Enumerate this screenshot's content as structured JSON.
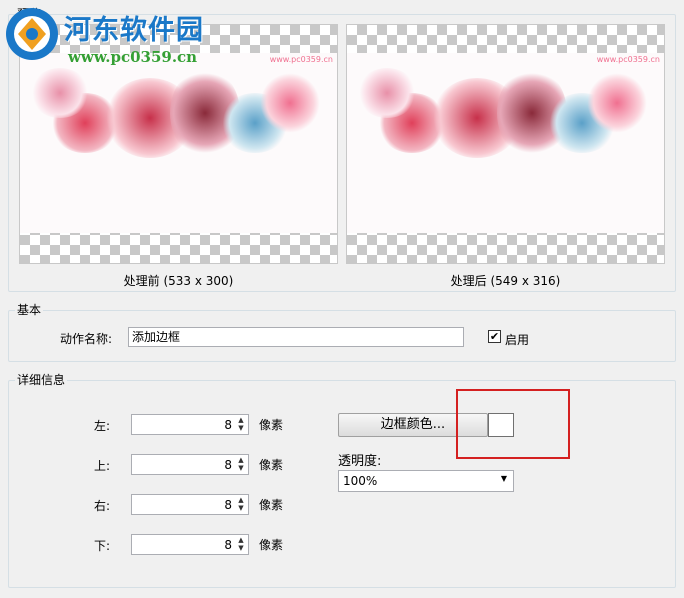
{
  "watermark": {
    "title": "河东软件园",
    "url": "www.pc0359.cn"
  },
  "preview": {
    "group_title": "预览",
    "before_label": "处理前 (533 x 300)",
    "after_label": "处理后 (549 x 316)",
    "image_tag": "www.pc0359.cn"
  },
  "basic": {
    "group_title": "基本",
    "action_name_label": "动作名称:",
    "action_name_value": "添加边框",
    "enable_label": "启用",
    "enable_checked": "✔"
  },
  "details": {
    "group_title": "详细信息",
    "fields": [
      {
        "label": "左:",
        "value": "8",
        "unit": "像素"
      },
      {
        "label": "上:",
        "value": "8",
        "unit": "像素"
      },
      {
        "label": "右:",
        "value": "8",
        "unit": "像素"
      },
      {
        "label": "下:",
        "value": "8",
        "unit": "像素"
      }
    ],
    "border_color_button": "边框颜色...",
    "border_color": "#ffffff",
    "opacity_label": "透明度:",
    "opacity_value": "100%"
  },
  "colors": {
    "highlight": "#d42020",
    "watermark_title": "#1a78c8",
    "watermark_url": "#35a035"
  }
}
